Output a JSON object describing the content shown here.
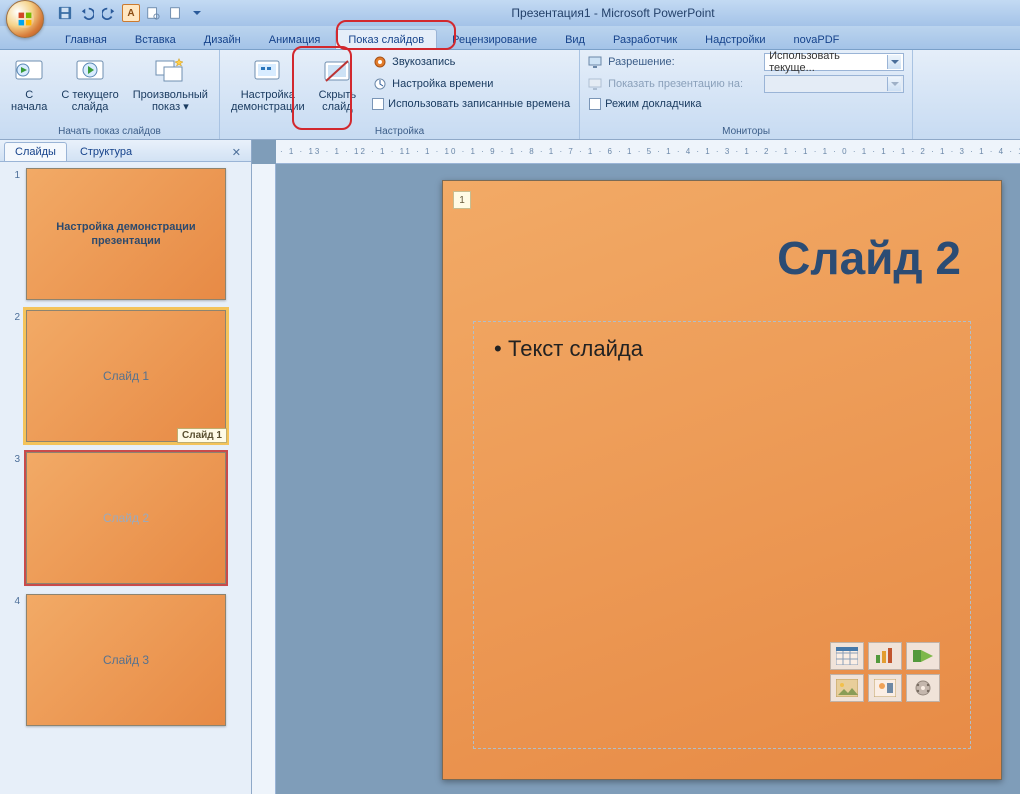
{
  "titlebar": {
    "doc_title": "Презентация1 - Microsoft PowerPoint"
  },
  "tabs": {
    "home": "Главная",
    "insert": "Вставка",
    "design": "Дизайн",
    "anim": "Анимация",
    "slideshow": "Показ слайдов",
    "review": "Рецензирование",
    "view": "Вид",
    "developer": "Разработчик",
    "addins": "Надстройки",
    "novapdf": "novaPDF"
  },
  "ribbon": {
    "start_group": {
      "label": "Начать показ слайдов",
      "from_start": "С\nначала",
      "from_current": "С текущего\nслайда",
      "custom": "Произвольный\nпоказ ▾"
    },
    "setup_group": {
      "label": "Настройка",
      "setup": "Настройка\nдемонстрации",
      "hide": "Скрыть\nслайд",
      "record": "Звукозапись",
      "rehearse": "Настройка времени",
      "use_timings": "Использовать записанные времена"
    },
    "monitors_group": {
      "label": "Мониторы",
      "resolution_lbl": "Разрешение:",
      "resolution_val": "Использовать текуще...",
      "show_on_lbl": "Показать презентацию на:",
      "presenter": "Режим докладчика"
    }
  },
  "sidepanel": {
    "tabs": {
      "slides": "Слайды",
      "outline": "Структура"
    },
    "thumbs": [
      {
        "num": "1",
        "title": "Настройка демонстрации презентации",
        "kind": "title"
      },
      {
        "num": "2",
        "title": "Слайд 1",
        "kind": "selected",
        "badge": "Слайд 1"
      },
      {
        "num": "3",
        "title": "Слайд 2",
        "kind": "hidden"
      },
      {
        "num": "4",
        "title": "Слайд 3",
        "kind": "normal"
      }
    ]
  },
  "ruler": "· 1 · 13 · 1 · 12 · 1 · 11 · 1 · 10 · 1 · 9 · 1 · 8 · 1 · 7 · 1 · 6 · 1 · 5 · 1 · 4 · 1 · 3 · 1 · 2 · 1 · 1 · 1 · 0 · 1 · 1 · 1 · 2 · 1 · 3 · 1 · 4 · 1",
  "slide": {
    "num": "1",
    "title": "Слайд 2",
    "body": "Текст слайда"
  }
}
